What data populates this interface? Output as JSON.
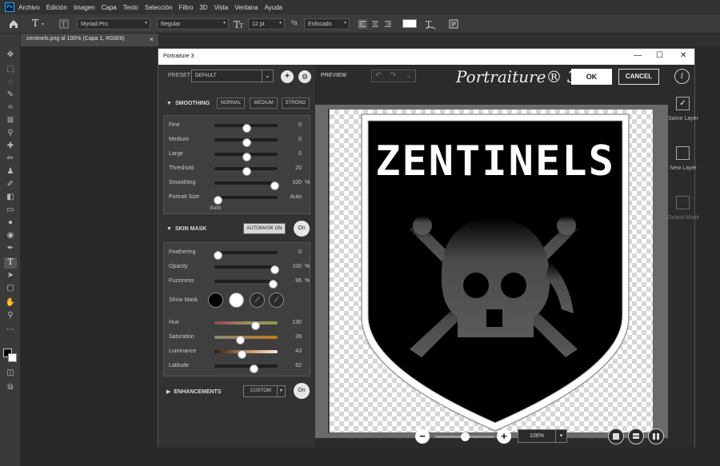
{
  "app": {
    "menu": [
      "Archivo",
      "Edición",
      "Imagen",
      "Capa",
      "Texto",
      "Selección",
      "Filtro",
      "3D",
      "Vista",
      "Ventana",
      "Ayuda"
    ],
    "ps_logo": "Ps",
    "options": {
      "tool_letter": "T",
      "font_family": "Myriad Pro",
      "font_style": "Regular",
      "font_size": "12 pt",
      "antialias": "Enfocado"
    },
    "document_tab": "zentinels.png al 100% (Capa 1, RGB/8)",
    "tab_close": "×"
  },
  "dialog": {
    "title": "Portraiture 3",
    "window_controls": {
      "minimize": "—",
      "maximize": "☐",
      "close": "✕"
    },
    "preset_label": "PRESET",
    "preset_value": "DEFAULT",
    "preview_label": "PREVIEW",
    "brand": "Portraiture® 3",
    "ok": "OK",
    "cancel": "CANCEL",
    "info": "i",
    "smoothing": {
      "header": "SMOOTHING",
      "normal": "NORMAL",
      "medium": "MEDIUM",
      "strong": "STRONG",
      "sliders": [
        {
          "name": "Fine",
          "value": "0",
          "unit": "",
          "pos": 0.5
        },
        {
          "name": "Medium",
          "value": "0",
          "unit": "",
          "pos": 0.5
        },
        {
          "name": "Large",
          "value": "0",
          "unit": "",
          "pos": 0.5
        },
        {
          "name": "Threshold",
          "value": "20",
          "unit": "",
          "pos": 0.5
        },
        {
          "name": "Smoothing",
          "value": "100",
          "unit": "%",
          "pos": 0.95
        },
        {
          "name": "Portrait Size",
          "value": "Auto",
          "unit": "",
          "pos": 0.05
        }
      ],
      "auto_note": "Auto"
    },
    "skin_mask": {
      "header": "SKIN MASK",
      "automask": "AUTOMASK ON",
      "toggle": "On",
      "sliders": [
        {
          "name": "Feathering",
          "value": "0",
          "unit": "",
          "pos": 0.05
        },
        {
          "name": "Opacity",
          "value": "100",
          "unit": "%",
          "pos": 0.95
        },
        {
          "name": "Fuzziness",
          "value": "96",
          "unit": "%",
          "pos": 0.93
        }
      ],
      "show_mask": "Show Mask",
      "color_sliders": [
        {
          "name": "Hue",
          "value": "130",
          "pos": 0.65,
          "track": "linear-gradient(90deg,#8a4a5a,#a08a5a,#8a9a4a)"
        },
        {
          "name": "Saturation",
          "value": "39",
          "pos": 0.4,
          "track": "linear-gradient(90deg,#8a8a7a,#c07820)"
        },
        {
          "name": "Luminance",
          "value": "43",
          "pos": 0.43,
          "track": "linear-gradient(90deg,#2a1a10,#c89060,#f5e6d8)"
        },
        {
          "name": "Latitude",
          "value": "62",
          "pos": 0.62,
          "track": "#1e1e1e"
        }
      ]
    },
    "enhancements": {
      "header": "ENHANCEMENTS",
      "preset": "CUSTOM",
      "toggle": "On"
    },
    "output": {
      "same_layer": "Same Layer",
      "new_layer": "New Layer",
      "output_mask": "Output Mask"
    },
    "zoom": "106%",
    "artwork_text": "ZENTINELS"
  }
}
